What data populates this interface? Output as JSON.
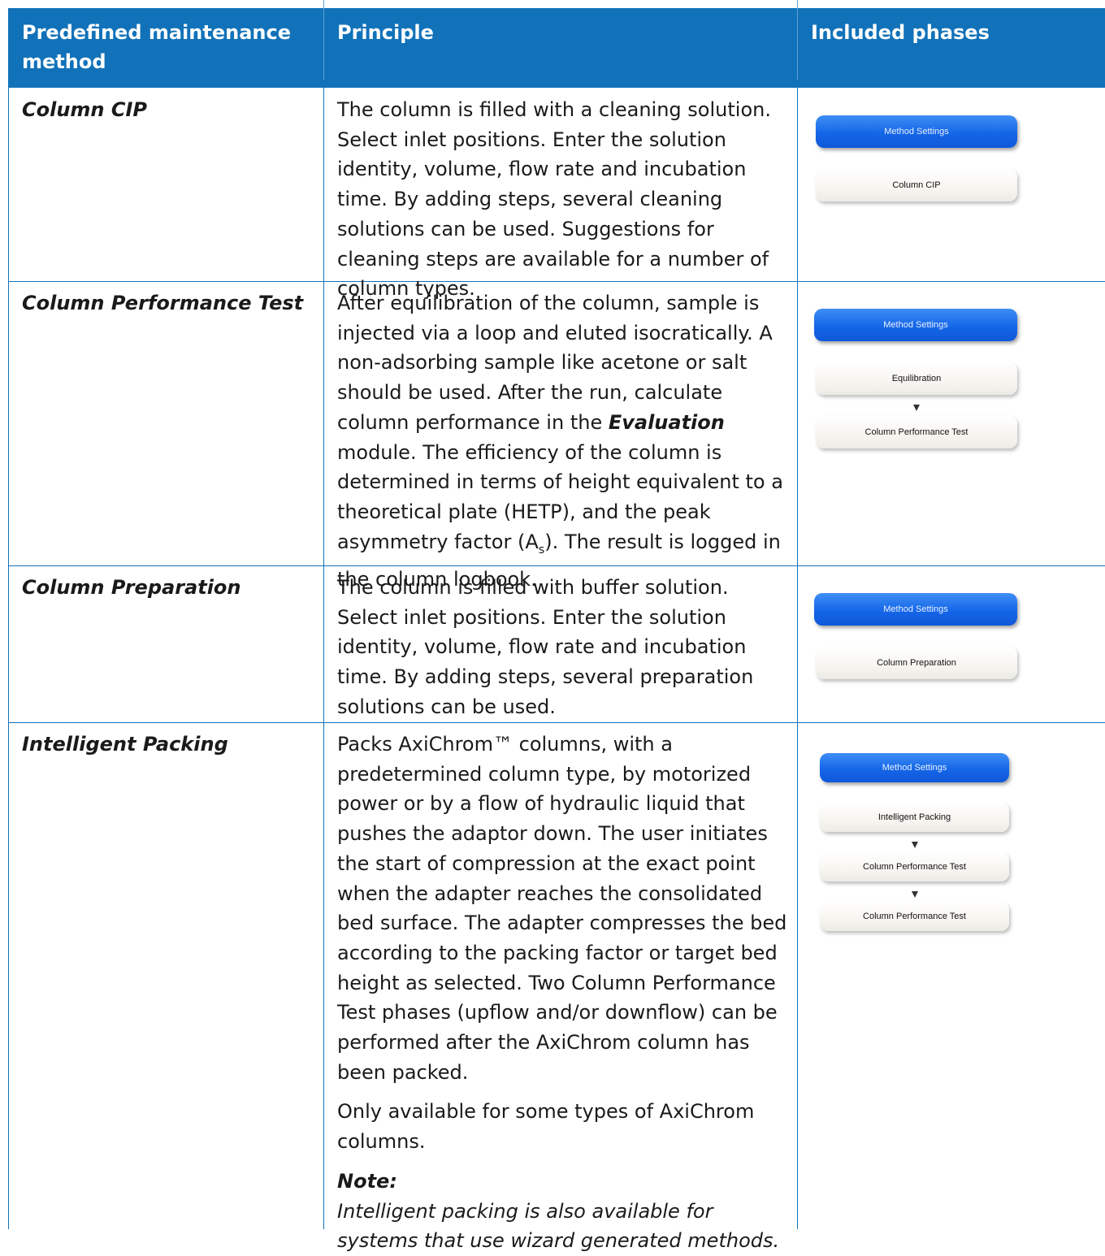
{
  "table": {
    "headers": [
      "Predefined maintenance method",
      "Principle",
      "Included phases"
    ],
    "rows": [
      {
        "method": "Column CIP",
        "principle": "The column is filled with a cleaning solution. Select inlet positions. Enter the solution identity, volume, flow rate and incubation time. By adding steps, several cleaning solutions can be used. Suggestions for cleaning steps are available for a number of column types.",
        "phases": [
          "Method Settings",
          "Column CIP"
        ]
      },
      {
        "method": "Column Performance Test",
        "principle_before": "After equilibration of the column, sample is injected via a loop and eluted isocratically. A non-adsorbing sample like acetone or salt should be used. After the run, calculate column performance in the ",
        "principle_emph": "Evaluation",
        "principle_mid": " module. The efficiency of the column is determined in terms of height equivalent to a theoretical plate (HETP), and the peak asymmetry factor (A",
        "principle_sub": "s",
        "principle_after": "). The result is logged in the column logbook.",
        "phases": [
          "Method Settings",
          "Equilibration",
          "Column Performance Test"
        ]
      },
      {
        "method": "Column Preparation",
        "principle": "The column is filled with buffer solution. Select inlet positions. Enter the solution identity, volume, flow rate and incubation time. By adding steps, several preparation solutions can be used.",
        "phases": [
          "Method Settings",
          "Column Preparation"
        ]
      },
      {
        "method": "Intelligent Packing",
        "principle": "Packs AxiChrom™ columns, with a predetermined column type, by motorized power or by a flow of hydraulic liquid that pushes the adaptor down. The user initiates the start of compression at the exact point when the adapter reaches the consolidated bed surface. The adapter compresses the bed according to the packing factor or target bed height as selected. Two Column Performance Test phases (upflow and/or downflow) can be performed after the AxiChrom column has been packed.",
        "principle_extra": "Only available for some types of AxiChrom columns.",
        "note_title": "Note:",
        "note_text": "Intelligent packing is also available for systems that use wizard generated methods.",
        "phases": [
          "Method Settings",
          "Intelligent Packing",
          "Column Performance Test",
          "Column Performance Test"
        ]
      }
    ]
  },
  "colors": {
    "header_bg": "#1172b9",
    "rule": "#1172b9",
    "button_blue": "#1566e8"
  }
}
